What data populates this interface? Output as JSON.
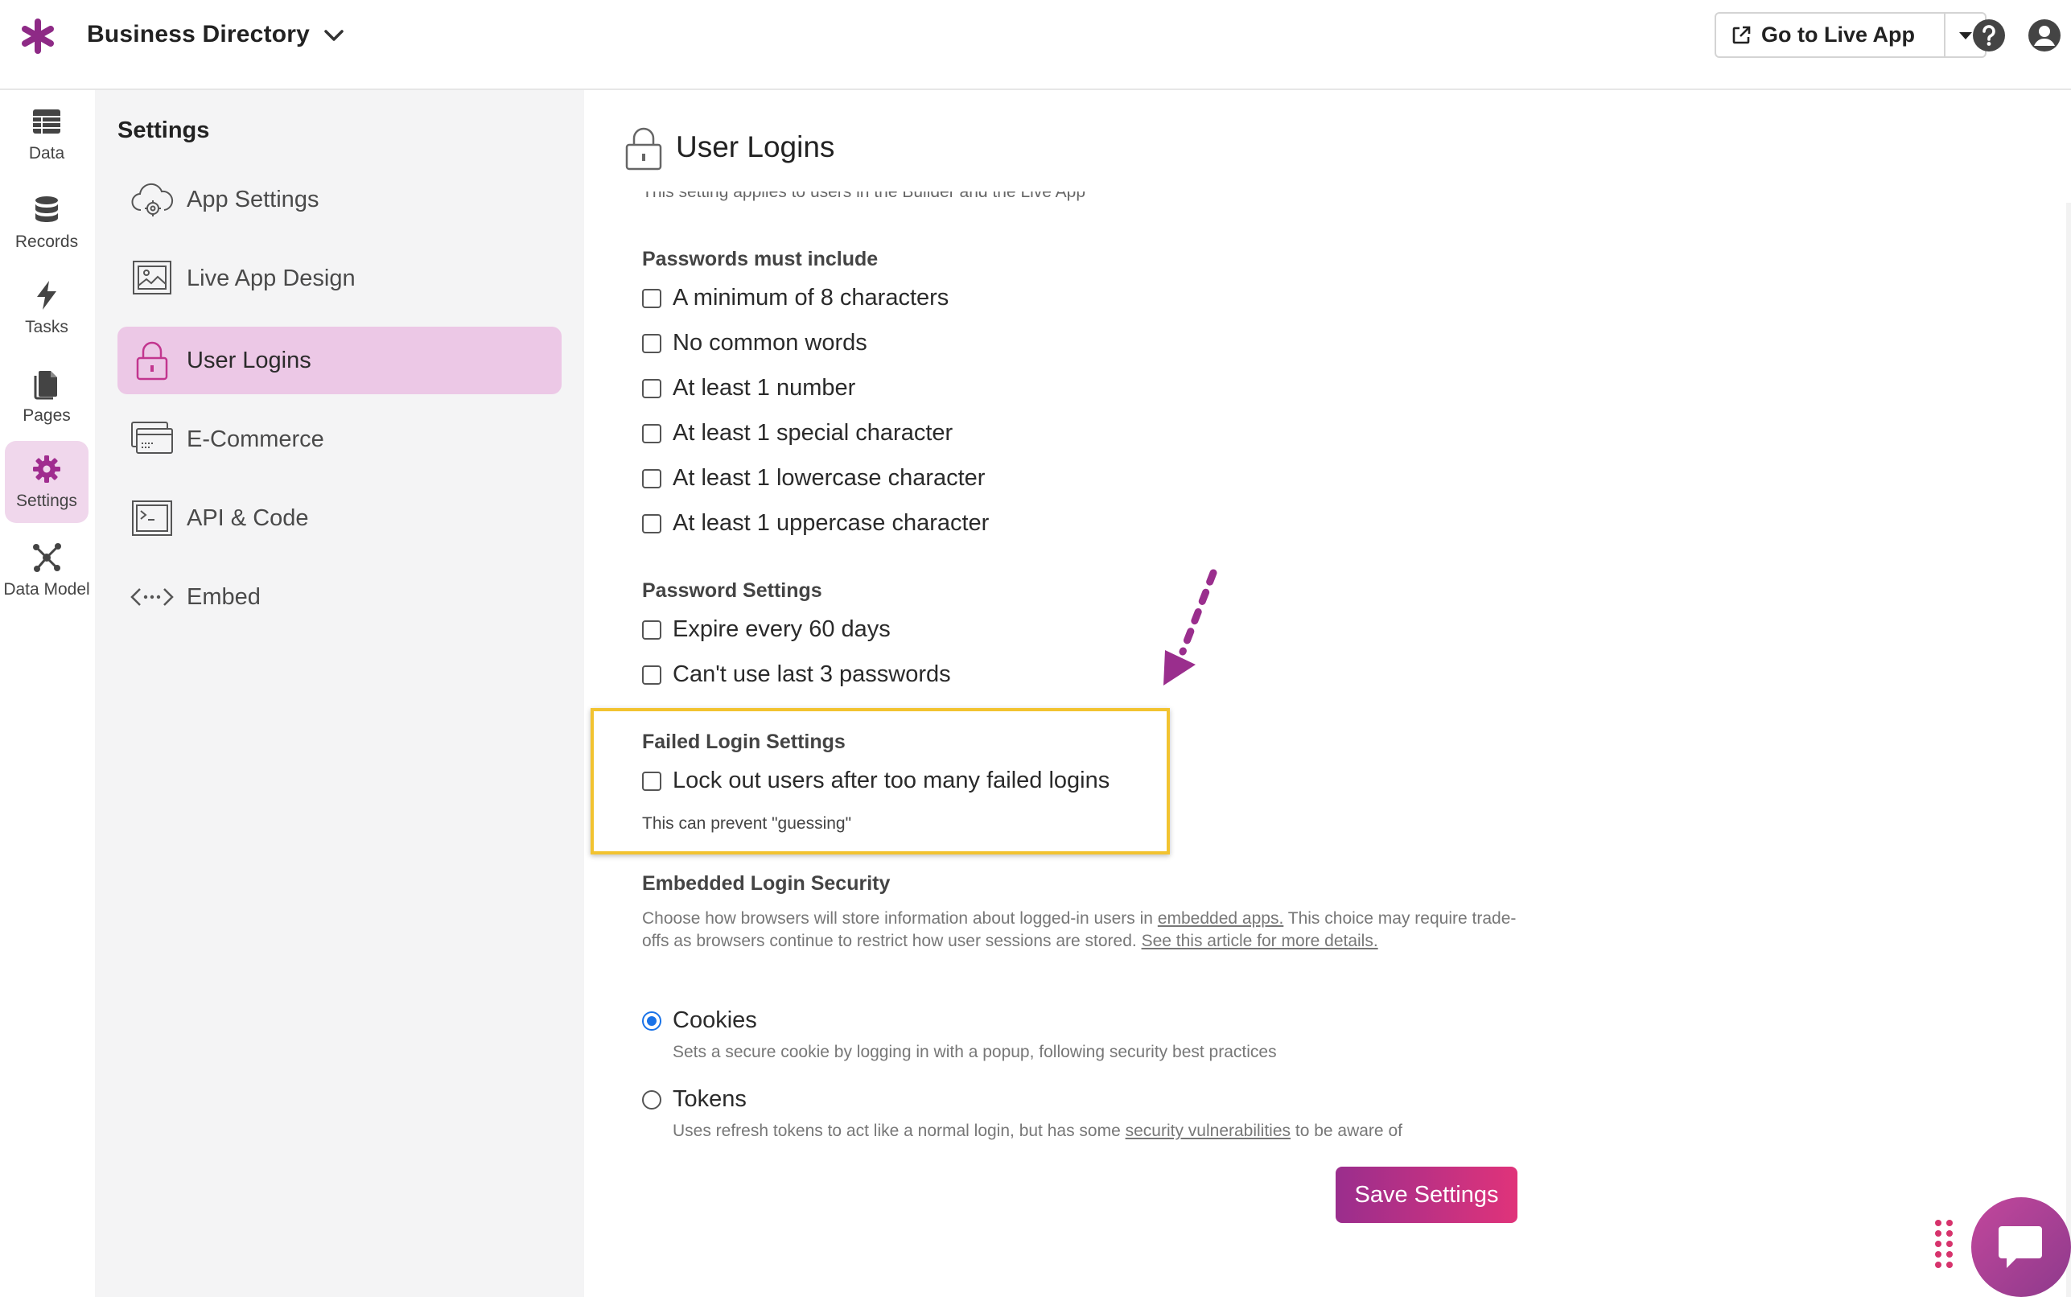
{
  "topbar": {
    "app_title": "Business Directory",
    "live_button_label": "Go to Live App"
  },
  "rail": {
    "items": [
      {
        "label": "Data",
        "icon": "table-icon"
      },
      {
        "label": "Records",
        "icon": "database-icon"
      },
      {
        "label": "Tasks",
        "icon": "lightning-icon"
      },
      {
        "label": "Pages",
        "icon": "pages-icon"
      },
      {
        "label": "Settings",
        "icon": "gear-icon",
        "active": true
      },
      {
        "label": "Data Model",
        "icon": "network-icon"
      }
    ]
  },
  "settings_panel": {
    "title": "Settings",
    "items": [
      {
        "label": "App Settings",
        "icon": "cloud-gear-icon"
      },
      {
        "label": "Live App Design",
        "icon": "image-icon"
      },
      {
        "label": "User Logins",
        "icon": "lock-icon",
        "active": true
      },
      {
        "label": "E-Commerce",
        "icon": "credit-card-icon"
      },
      {
        "label": "API & Code",
        "icon": "terminal-icon"
      },
      {
        "label": "Embed",
        "icon": "embed-code-icon"
      }
    ]
  },
  "main": {
    "title": "User Logins",
    "cut_text": "This setting applies to users in the Builder and the Live App",
    "passwords_section": {
      "label": "Passwords must include",
      "options": [
        "A minimum of 8 characters",
        "No common words",
        "At least 1 number",
        "At least 1 special character",
        "At least 1 lowercase character",
        "At least 1 uppercase character"
      ]
    },
    "password_settings": {
      "label": "Password Settings",
      "options": [
        "Expire every 60 days",
        "Can't use last 3 passwords"
      ]
    },
    "failed_login": {
      "label": "Failed Login Settings",
      "option": "Lock out users after too many failed logins",
      "hint": "This can prevent \"guessing\""
    },
    "embedded_security": {
      "label": "Embedded Login Security",
      "desc_part1": "Choose how browsers will store information about logged-in users in ",
      "desc_link1": "embedded apps.",
      "desc_part2": " This choice may require trade-offs as browsers continue to restrict how user sessions are stored. ",
      "desc_link2": "See this article for more details.",
      "cookies_label": "Cookies",
      "cookies_desc": "Sets a secure cookie by logging in with a popup, following security best practices",
      "tokens_label": "Tokens",
      "tokens_desc_part1": "Uses refresh tokens to act like a normal login, but has some ",
      "tokens_desc_link": "security vulnerabilities",
      "tokens_desc_part2": " to be aware of",
      "selected": "Cookies"
    },
    "save_label": "Save Settings"
  },
  "colors": {
    "brand": "#9a2e8d",
    "active_rail": "#f0d7ec",
    "active_panel": "#ecc8e6",
    "highlight": "#f2c330",
    "radio_selected": "#1a73e8"
  }
}
